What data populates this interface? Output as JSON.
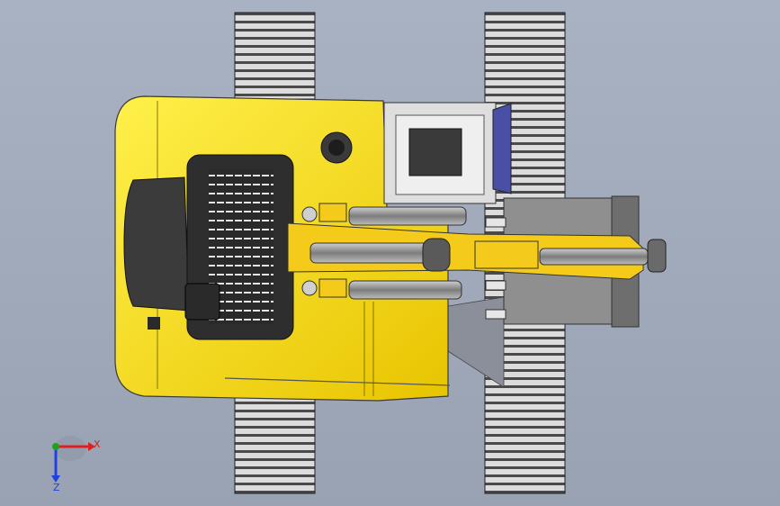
{
  "viewport": {
    "background_top": "#a9b2c2",
    "background_bottom": "#99a2b3"
  },
  "model": {
    "body_color": "#f2d417",
    "track_color": "#d6d6d6",
    "cab_window_color": "#4a4fa6",
    "cylinder_color": "#9a9a9a"
  },
  "triad": {
    "x_label": "X",
    "z_label": "Z",
    "x_color": "#e02020",
    "y_color": "#20a020",
    "z_color": "#2040e0"
  }
}
